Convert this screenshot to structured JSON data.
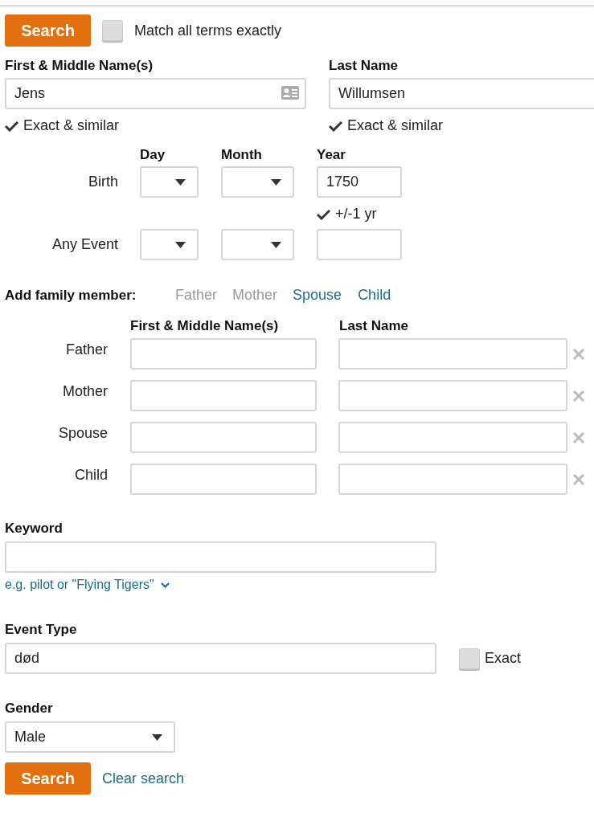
{
  "top_search_button": "Search",
  "match_exactly": {
    "label": "Match all terms exactly",
    "checked": false
  },
  "name_fields": [
    {
      "label": "First & Middle Name(s)",
      "value": "Jens",
      "option": "Exact & similar"
    },
    {
      "label": "Last Name",
      "value": "Willumsen",
      "option": "Exact & similar"
    }
  ],
  "date_columns": [
    "Day",
    "Month",
    "Year"
  ],
  "date_rows": [
    {
      "label": "Birth",
      "year": "1750",
      "year_option": "+/-1 yr"
    },
    {
      "label": "Any Event"
    }
  ],
  "family": {
    "label": "Add family member:",
    "links": [
      {
        "label": "Father",
        "disabled": true
      },
      {
        "label": "Mother",
        "disabled": true
      },
      {
        "label": "Spouse",
        "disabled": false
      },
      {
        "label": "Child",
        "disabled": false
      }
    ],
    "columns": [
      "First & Middle Name(s)",
      "Last Name"
    ],
    "rows": [
      {
        "label": "Father"
      },
      {
        "label": "Mother"
      },
      {
        "label": "Spouse"
      },
      {
        "label": "Child"
      }
    ]
  },
  "keyword": {
    "label": "Keyword",
    "hint": "e.g. pilot or \"Flying Tigers\""
  },
  "event_type": {
    "label": "Event Type",
    "value": "død",
    "exact": {
      "label": "Exact",
      "checked": false
    }
  },
  "gender": {
    "label": "Gender",
    "value": "Male"
  },
  "bottom_buttons": {
    "search": "Search",
    "clear": "Clear search"
  }
}
